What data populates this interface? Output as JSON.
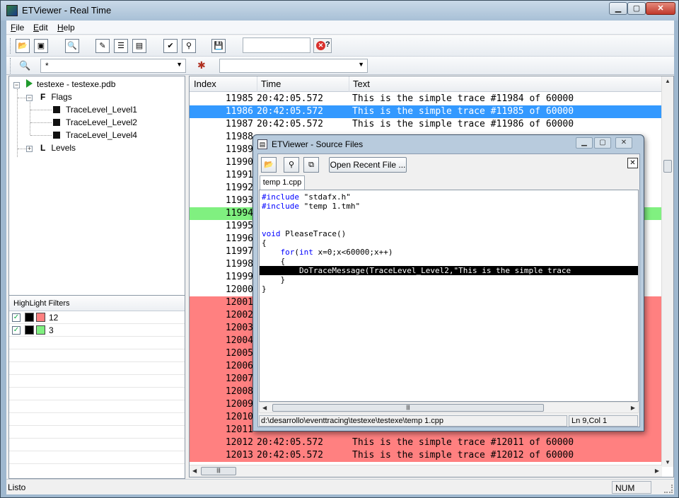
{
  "window": {
    "title": "ETViewer - Real Time",
    "min": "▁",
    "max": "▢",
    "close": "✕"
  },
  "menu": [
    {
      "label": "F",
      "rest": "ile"
    },
    {
      "label": "E",
      "rest": "dit"
    },
    {
      "label": "H",
      "rest": "elp"
    }
  ],
  "toolbar": {
    "search_value": "",
    "filter_value": "*",
    "highlight_value": ""
  },
  "tree": {
    "root": "testexe - testexe.pdb",
    "flags": "Flags",
    "levels_items": [
      "TraceLevel_Level1",
      "TraceLevel_Level2",
      "TraceLevel_Level4"
    ],
    "levels": "Levels"
  },
  "highlight_filters": {
    "header": "HighLight Filters",
    "items": [
      {
        "text": "12",
        "bg": "#ff8080",
        "checked": true
      },
      {
        "text": "3",
        "bg": "#80f080",
        "checked": true
      }
    ]
  },
  "trace_list": {
    "columns": [
      "Index",
      "Time",
      "Text"
    ],
    "rows": [
      {
        "idx": "11985",
        "time": "20:42:05.572",
        "text": "This is the simple trace #11984 of 60000",
        "style": "normal"
      },
      {
        "idx": "11986",
        "time": "20:42:05.572",
        "text": "This is the simple trace #11985 of 60000",
        "style": "sel"
      },
      {
        "idx": "11987",
        "time": "20:42:05.572",
        "text": "This is the simple trace #11986 of 60000",
        "style": "normal"
      },
      {
        "idx": "11988",
        "time": "",
        "text": "",
        "style": "normal"
      },
      {
        "idx": "11989",
        "time": "",
        "text": "",
        "style": "normal"
      },
      {
        "idx": "11990",
        "time": "",
        "text": "",
        "style": "normal"
      },
      {
        "idx": "11991",
        "time": "",
        "text": "",
        "style": "normal"
      },
      {
        "idx": "11992",
        "time": "",
        "text": "",
        "style": "normal"
      },
      {
        "idx": "11993",
        "time": "",
        "text": "",
        "style": "normal"
      },
      {
        "idx": "11994",
        "time": "",
        "text": "",
        "style": "green"
      },
      {
        "idx": "11995",
        "time": "",
        "text": "",
        "style": "normal"
      },
      {
        "idx": "11996",
        "time": "",
        "text": "",
        "style": "normal"
      },
      {
        "idx": "11997",
        "time": "",
        "text": "",
        "style": "normal"
      },
      {
        "idx": "11998",
        "time": "",
        "text": "",
        "style": "normal"
      },
      {
        "idx": "11999",
        "time": "",
        "text": "",
        "style": "normal"
      },
      {
        "idx": "12000",
        "time": "",
        "text": "",
        "style": "normal"
      },
      {
        "idx": "12001",
        "time": "",
        "text": "",
        "style": "red"
      },
      {
        "idx": "12002",
        "time": "",
        "text": "",
        "style": "red"
      },
      {
        "idx": "12003",
        "time": "",
        "text": "",
        "style": "red"
      },
      {
        "idx": "12004",
        "time": "",
        "text": "",
        "style": "red"
      },
      {
        "idx": "12005",
        "time": "",
        "text": "",
        "style": "red"
      },
      {
        "idx": "12006",
        "time": "",
        "text": "",
        "style": "red"
      },
      {
        "idx": "12007",
        "time": "",
        "text": "",
        "style": "red"
      },
      {
        "idx": "12008",
        "time": "",
        "text": "",
        "style": "red"
      },
      {
        "idx": "12009",
        "time": "",
        "text": "",
        "style": "red"
      },
      {
        "idx": "12010",
        "time": "",
        "text": "",
        "style": "red"
      },
      {
        "idx": "12011",
        "time": "",
        "text": "",
        "style": "red"
      },
      {
        "idx": "12012",
        "time": "20:42:05.572",
        "text": "This is the simple trace #12011 of 60000",
        "style": "red"
      },
      {
        "idx": "12013",
        "time": "20:42:05.572",
        "text": "This is the simple trace #12012 of 60000",
        "style": "red"
      }
    ]
  },
  "status": {
    "text": "Listo",
    "num": "NUM"
  },
  "source_dialog": {
    "title": "ETViewer - Source Files",
    "open_recent": "Open Recent File ...",
    "tab": "temp 1.cpp",
    "code": [
      {
        "t": "#include \"stdafx.h\"",
        "kw": "#include"
      },
      {
        "t": "#include \"temp 1.tmh\"",
        "kw": "#include"
      },
      {
        "t": "",
        "kw": ""
      },
      {
        "t": "",
        "kw": ""
      },
      {
        "t": "void PleaseTrace()",
        "kw": "void"
      },
      {
        "t": "{",
        "kw": ""
      },
      {
        "t": "    for(int x=0;x<60000;x++)",
        "kw": "for"
      },
      {
        "t": "    {",
        "kw": ""
      },
      {
        "t": "        DoTraceMessage(TraceLevel_Level2,\"This is the simple trace",
        "kw": "",
        "hl": true
      },
      {
        "t": "    }",
        "kw": ""
      },
      {
        "t": "}",
        "kw": ""
      }
    ],
    "path": "d:\\desarrollo\\eventtracing\\testexe\\testexe\\temp 1.cpp",
    "position": "Ln 9,Col 1"
  }
}
